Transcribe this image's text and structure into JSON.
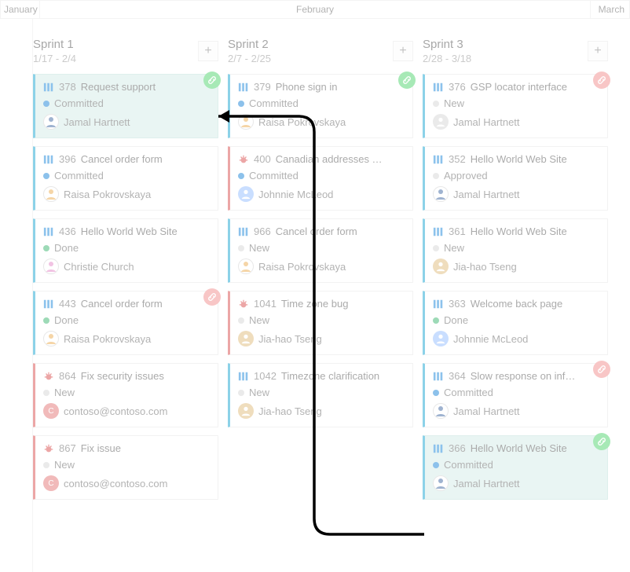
{
  "months": {
    "m1": "January",
    "m2": "February",
    "m3": "March"
  },
  "columns": [
    {
      "title": "Sprint 1",
      "range": "1/17 - 2/4",
      "cards": [
        {
          "type": "pbi",
          "id": "378",
          "title": "Request support",
          "state": "Committed",
          "person": "Jamal Hartnett",
          "avatar": "jamal",
          "link": "green",
          "focus": true
        },
        {
          "type": "pbi",
          "id": "396",
          "title": "Cancel order form",
          "state": "Committed",
          "person": "Raisa Pokrovskaya",
          "avatar": "raisa"
        },
        {
          "type": "pbi",
          "id": "436",
          "title": "Hello World Web Site",
          "state": "Done",
          "person": "Christie Church",
          "avatar": "christie"
        },
        {
          "type": "pbi",
          "id": "443",
          "title": "Cancel order form",
          "state": "Done",
          "person": "Raisa Pokrovskaya",
          "avatar": "raisa",
          "link": "red"
        },
        {
          "type": "bug",
          "id": "864",
          "title": "Fix security issues",
          "state": "New",
          "person": "contoso@contoso.com",
          "avatar": "c"
        },
        {
          "type": "bug",
          "id": "867",
          "title": "Fix issue",
          "state": "New",
          "person": "contoso@contoso.com",
          "avatar": "c"
        }
      ]
    },
    {
      "title": "Sprint 2",
      "range": "2/7 - 2/25",
      "cards": [
        {
          "type": "pbi",
          "id": "379",
          "title": "Phone sign in",
          "state": "Committed",
          "person": "Raisa Pokrovskaya",
          "avatar": "raisa",
          "link": "green"
        },
        {
          "type": "bug",
          "id": "400",
          "title": "Canadian addresses …",
          "state": "Committed",
          "person": "Johnnie McLeod",
          "avatar": "johnnie"
        },
        {
          "type": "pbi",
          "id": "966",
          "title": "Cancel order form",
          "state": "New",
          "person": "Raisa Pokrovskaya",
          "avatar": "raisa"
        },
        {
          "type": "bug",
          "id": "1041",
          "title": "Time zone bug",
          "state": "New",
          "person": "Jia-hao Tseng",
          "avatar": "jiahao"
        },
        {
          "type": "pbi",
          "id": "1042",
          "title": "Timezone clarification",
          "state": "New",
          "person": "Jia-hao Tseng",
          "avatar": "jiahao"
        }
      ]
    },
    {
      "title": "Sprint 3",
      "range": "2/28 - 3/18",
      "cards": [
        {
          "type": "pbi",
          "id": "376",
          "title": "GSP locator interface",
          "state": "New",
          "person": "Jamal Hartnett",
          "avatar": "generic",
          "link": "red"
        },
        {
          "type": "pbi",
          "id": "352",
          "title": "Hello World Web Site",
          "state": "Approved",
          "person": "Jamal Hartnett",
          "avatar": "jamal"
        },
        {
          "type": "pbi",
          "id": "361",
          "title": "Hello World Web Site",
          "state": "New",
          "person": "Jia-hao Tseng",
          "avatar": "jiahao"
        },
        {
          "type": "pbi",
          "id": "363",
          "title": "Welcome back page",
          "state": "Done",
          "person": "Johnnie McLeod",
          "avatar": "johnnie"
        },
        {
          "type": "pbi",
          "id": "364",
          "title": "Slow response on inf…",
          "state": "Committed",
          "person": "Jamal Hartnett",
          "avatar": "jamal",
          "link": "red"
        },
        {
          "type": "pbi",
          "id": "366",
          "title": "Hello World Web Site",
          "state": "Committed",
          "person": "Jamal Hartnett",
          "avatar": "jamal",
          "link": "green",
          "focus": true
        }
      ]
    }
  ],
  "chart_data": {
    "type": "table",
    "title": "Sprint plan timeline",
    "columns": [
      "Sprint 1 (1/17 - 2/4)",
      "Sprint 2 (2/7 - 2/25)",
      "Sprint 3 (2/28 - 3/18)"
    ],
    "rows": [
      [
        "378 Request support — Committed — Jamal Hartnett",
        "379 Phone sign in — Committed — Raisa Pokrovskaya",
        "376 GSP locator interface — New — Jamal Hartnett"
      ],
      [
        "396 Cancel order form — Committed — Raisa Pokrovskaya",
        "400 Canadian addresses … — Committed — Johnnie McLeod",
        "352 Hello World Web Site — Approved — Jamal Hartnett"
      ],
      [
        "436 Hello World Web Site — Done — Christie Church",
        "966 Cancel order form — New — Raisa Pokrovskaya",
        "361 Hello World Web Site — New — Jia-hao Tseng"
      ],
      [
        "443 Cancel order form — Done — Raisa Pokrovskaya",
        "1041 Time zone bug — New — Jia-hao Tseng",
        "363 Welcome back page — Done — Johnnie McLeod"
      ],
      [
        "864 Fix security issues — New — contoso@contoso.com",
        "1042 Timezone clarification — New — Jia-hao Tseng",
        "364 Slow response on inf… — Committed — Jamal Hartnett"
      ],
      [
        "867 Fix issue — New — contoso@contoso.com",
        "",
        "366 Hello World Web Site — Committed — Jamal Hartnett"
      ]
    ]
  }
}
